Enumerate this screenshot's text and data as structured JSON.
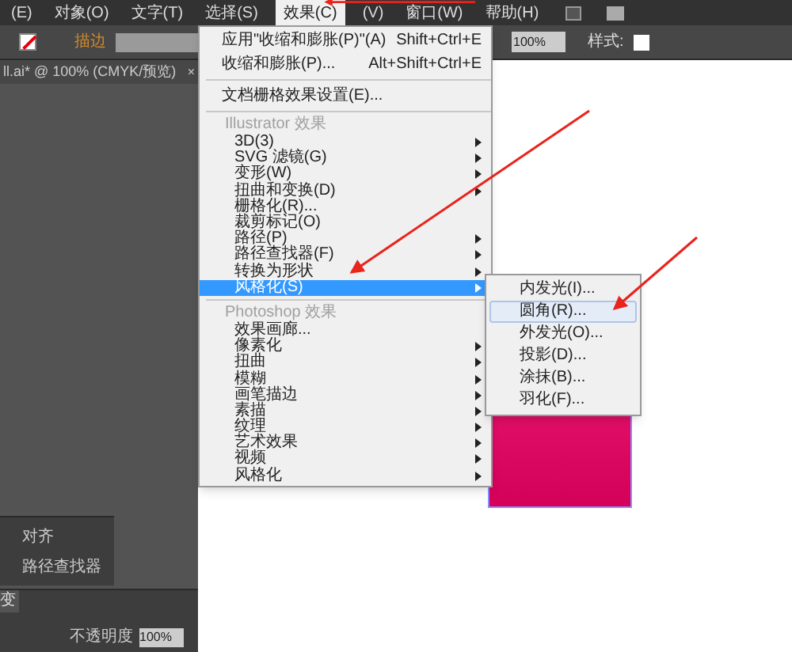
{
  "menu_bar": [
    {
      "label": "(E)",
      "selected": false
    },
    {
      "label": "对象(O)",
      "selected": false
    },
    {
      "label": "文字(T)",
      "selected": false
    },
    {
      "label": "选择(S)",
      "selected": false
    },
    {
      "label": "效果(C)",
      "selected": true
    },
    {
      "label": "(V)",
      "selected": false
    },
    {
      "label": "窗口(W)",
      "selected": false
    },
    {
      "label": "帮助(H)",
      "selected": false
    }
  ],
  "control_bar": {
    "stroke_label": "描边",
    "opacity_value": "100%",
    "style_label": "样式:"
  },
  "document_tab": {
    "title": "ll.ai* @ 100% (CMYK/预览)",
    "close": "×"
  },
  "effect_menu": {
    "items": [
      {
        "kind": "command",
        "label": "应用\"收缩和膨胀(P)\"(A)",
        "shortcut": "Shift+Ctrl+E"
      },
      {
        "kind": "command",
        "label": "收缩和膨胀(P)...",
        "shortcut": "Alt+Shift+Ctrl+E"
      },
      {
        "kind": "separator"
      },
      {
        "kind": "command",
        "label": "文档栅格效果设置(E)..."
      },
      {
        "kind": "separator"
      },
      {
        "kind": "header",
        "label": "Illustrator 效果"
      },
      {
        "kind": "effect",
        "label": "3D(3)",
        "submenu": true,
        "selected": false
      },
      {
        "kind": "effect",
        "label": "SVG 滤镜(G)",
        "submenu": true,
        "selected": false
      },
      {
        "kind": "effect",
        "label": "变形(W)",
        "submenu": true,
        "selected": false
      },
      {
        "kind": "effect",
        "label": "扭曲和变换(D)",
        "submenu": true,
        "selected": false
      },
      {
        "kind": "effect",
        "label": "栅格化(R)...",
        "submenu": false,
        "selected": false
      },
      {
        "kind": "effect",
        "label": "裁剪标记(O)",
        "submenu": false,
        "selected": false
      },
      {
        "kind": "effect",
        "label": "路径(P)",
        "submenu": true,
        "selected": false
      },
      {
        "kind": "effect",
        "label": "路径查找器(F)",
        "submenu": true,
        "selected": false
      },
      {
        "kind": "effect",
        "label": "转换为形状",
        "submenu": true,
        "selected": false
      },
      {
        "kind": "effect",
        "label": "风格化(S)",
        "submenu": true,
        "selected": true
      },
      {
        "kind": "separator"
      },
      {
        "kind": "header",
        "label": "Photoshop 效果"
      },
      {
        "kind": "effect",
        "label": "效果画廊...",
        "submenu": false,
        "selected": false
      },
      {
        "kind": "effect",
        "label": "像素化",
        "submenu": true,
        "selected": false
      },
      {
        "kind": "effect",
        "label": "扭曲",
        "submenu": true,
        "selected": false
      },
      {
        "kind": "effect",
        "label": "模糊",
        "submenu": true,
        "selected": false
      },
      {
        "kind": "effect",
        "label": "画笔描边",
        "submenu": true,
        "selected": false
      },
      {
        "kind": "effect",
        "label": "素描",
        "submenu": true,
        "selected": false
      },
      {
        "kind": "effect",
        "label": "纹理",
        "submenu": true,
        "selected": false
      },
      {
        "kind": "effect",
        "label": "艺术效果",
        "submenu": true,
        "selected": false
      },
      {
        "kind": "effect",
        "label": "视频",
        "submenu": true,
        "selected": false
      },
      {
        "kind": "effect",
        "label": "风格化",
        "submenu": true,
        "selected": false
      }
    ]
  },
  "stylize_submenu": {
    "items": [
      {
        "label": "内发光(I)...",
        "selected": false
      },
      {
        "label": "圆角(R)...",
        "selected": true
      },
      {
        "label": "外发光(O)...",
        "selected": false
      },
      {
        "label": "投影(D)...",
        "selected": false
      },
      {
        "label": "涂抹(B)...",
        "selected": false
      },
      {
        "label": "羽化(F)...",
        "selected": false
      }
    ]
  },
  "panels": {
    "align_label": "对齐",
    "pathfinder_label": "路径查找器",
    "tab_label": "变",
    "opacity_label": "不透明度",
    "opacity_value": "100%"
  }
}
